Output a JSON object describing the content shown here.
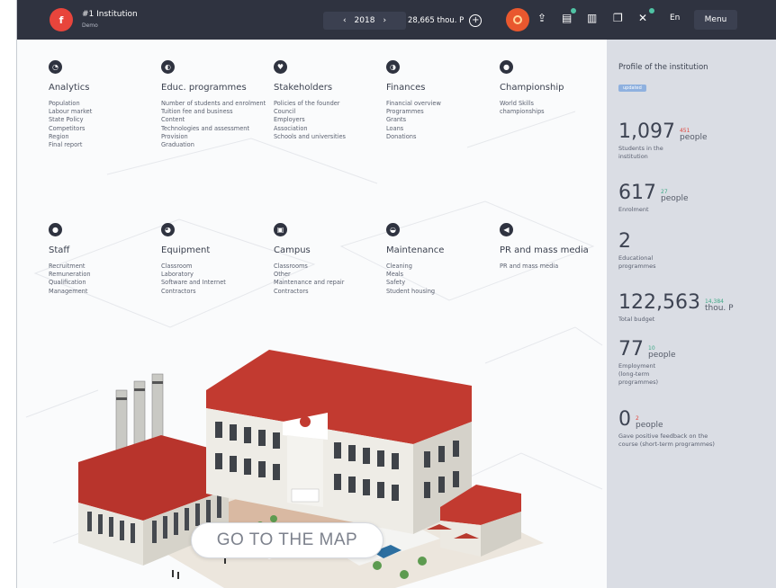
{
  "topbar": {
    "institution": "#1 Institution",
    "institution_sub": "Demo",
    "logo_glyph": "f",
    "year": "2018",
    "prev_arrow": "‹",
    "next_arrow": "›",
    "budget": "28,665 thou. P",
    "lang": "En",
    "menu": "Menu",
    "icons": [
      "alarm-icon",
      "share-icon",
      "document-icon",
      "bar-chart-icon",
      "copy-icon",
      "tools-icon"
    ]
  },
  "categories": [
    {
      "title": "Analytics",
      "icon": "analytics-icon",
      "items": [
        "Population",
        "Labour market",
        "State Policy",
        "Competitors",
        "Region",
        "Final report"
      ]
    },
    {
      "title": "Educ. programmes",
      "icon": "education-icon",
      "items": [
        "Number of students and enrolment",
        "Tuition fee and business",
        "Content",
        "Technologies and assessment",
        "Provision",
        "Graduation"
      ]
    },
    {
      "title": "Stakeholders",
      "icon": "heart-icon",
      "items": [
        "Policies of the founder",
        "Council",
        "Employers",
        "Association",
        "Schools and universities"
      ]
    },
    {
      "title": "Finances",
      "icon": "finances-icon",
      "items": [
        "Financial overview",
        "Programmes",
        "Grants",
        "Loans",
        "Donations"
      ]
    },
    {
      "title": "Championship",
      "icon": "championship-icon",
      "items": [
        "World Skills championships"
      ]
    },
    {
      "title": "Staff",
      "icon": "staff-icon",
      "items": [
        "Recruitment",
        "Remuneration",
        "Qualification",
        "Management"
      ]
    },
    {
      "title": "Equipment",
      "icon": "equipment-icon",
      "items": [
        "Classroom",
        "Laboratory",
        "Software and Internet",
        "Contractors"
      ]
    },
    {
      "title": "Campus",
      "icon": "campus-icon",
      "items": [
        "Classrooms",
        "Other",
        "Maintenance and repair",
        "Contractors"
      ]
    },
    {
      "title": "Maintenance",
      "icon": "maintenance-icon",
      "items": [
        "Cleaning",
        "Meals",
        "Safety",
        "Student housing"
      ]
    },
    {
      "title": "PR and mass media",
      "icon": "megaphone-icon",
      "items": [
        "PR and mass media"
      ]
    }
  ],
  "map_button": "GO TO THE MAP",
  "profile": {
    "title": "Profile of the institution",
    "badge": "updated",
    "stats": [
      {
        "value": "1,097",
        "delta": "451",
        "delta_color": "red",
        "unit": "people",
        "desc": "Students in the institution"
      },
      {
        "value": "617",
        "delta": "27",
        "delta_color": "green",
        "unit": "people",
        "desc": "Enrolment"
      },
      {
        "value": "2",
        "delta": "",
        "delta_color": "green",
        "unit": "",
        "desc": "Educational programmes"
      },
      {
        "value": "122,563",
        "delta": "14,384",
        "delta_color": "green",
        "unit": "thou. P",
        "desc": "Total budget"
      },
      {
        "value": "77",
        "delta": "10",
        "delta_color": "green",
        "unit": "people",
        "desc": "Employment (long-term programmes)"
      },
      {
        "value": "0",
        "delta": "2",
        "delta_color": "red",
        "unit": "people",
        "desc": "Gave positive feedback on the course (short-term programmes)"
      }
    ]
  }
}
